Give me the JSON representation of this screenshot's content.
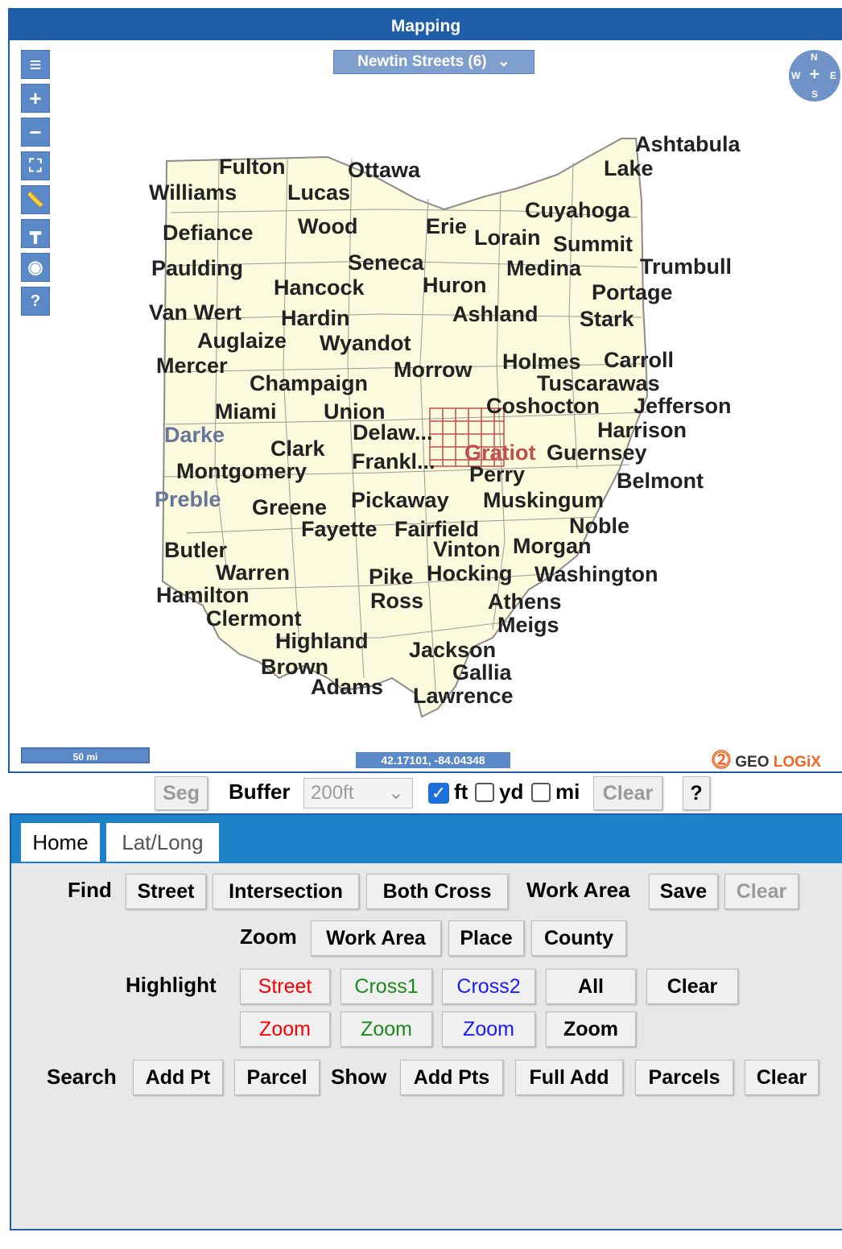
{
  "window": {
    "title": "Mapping"
  },
  "map": {
    "layer_selector": "Newtin Streets (6)",
    "compass": {
      "n": "N",
      "s": "S",
      "e": "E",
      "w": "W"
    },
    "tools": [
      "menu-icon",
      "zoom-in-icon",
      "zoom-out-icon",
      "full-extent-icon",
      "measure-icon",
      "street-view-icon",
      "visibility-icon",
      "help-icon"
    ],
    "scale_label": "50 mi",
    "coordinates": "42.17101, -84.04348",
    "logo": {
      "geo": "GEO",
      "logix": "LOGiX"
    },
    "counties": [
      {
        "name": "Ashtabula"
      },
      {
        "name": "Lake"
      },
      {
        "name": "Fulton"
      },
      {
        "name": "Ottawa"
      },
      {
        "name": "Williams"
      },
      {
        "name": "Lucas"
      },
      {
        "name": "Cuyahoga"
      },
      {
        "name": "Defiance"
      },
      {
        "name": "Wood"
      },
      {
        "name": "Erie"
      },
      {
        "name": "Lorain"
      },
      {
        "name": "Summit"
      },
      {
        "name": "Paulding"
      },
      {
        "name": "Seneca"
      },
      {
        "name": "Medina"
      },
      {
        "name": "Trumbull"
      },
      {
        "name": "Hancock"
      },
      {
        "name": "Huron"
      },
      {
        "name": "Portage"
      },
      {
        "name": "Van Wert"
      },
      {
        "name": "Hardin"
      },
      {
        "name": "Ashland"
      },
      {
        "name": "Stark"
      },
      {
        "name": "Auglaize"
      },
      {
        "name": "Wyandot"
      },
      {
        "name": "Mercer"
      },
      {
        "name": "Morrow"
      },
      {
        "name": "Holmes"
      },
      {
        "name": "Carroll"
      },
      {
        "name": "Champaign"
      },
      {
        "name": "Tuscarawas"
      },
      {
        "name": "Miami"
      },
      {
        "name": "Union"
      },
      {
        "name": "Coshocton"
      },
      {
        "name": "Jefferson"
      },
      {
        "name": "Darke"
      },
      {
        "name": "Delaw..."
      },
      {
        "name": "Harrison"
      },
      {
        "name": "Clark"
      },
      {
        "name": "Gratiot"
      },
      {
        "name": "Guernsey"
      },
      {
        "name": "Montgomery"
      },
      {
        "name": "Frankl..."
      },
      {
        "name": "Perry"
      },
      {
        "name": "Belmont"
      },
      {
        "name": "Preble"
      },
      {
        "name": "Greene"
      },
      {
        "name": "Pickaway"
      },
      {
        "name": "Muskingum"
      },
      {
        "name": "Fayette"
      },
      {
        "name": "Fairfield"
      },
      {
        "name": "Noble"
      },
      {
        "name": "Butler"
      },
      {
        "name": "Vinton"
      },
      {
        "name": "Morgan"
      },
      {
        "name": "Warren"
      },
      {
        "name": "Pike"
      },
      {
        "name": "Hocking"
      },
      {
        "name": "Washington"
      },
      {
        "name": "Hamilton"
      },
      {
        "name": "Ross"
      },
      {
        "name": "Athens"
      },
      {
        "name": "Clermont"
      },
      {
        "name": "Meigs"
      },
      {
        "name": "Highland"
      },
      {
        "name": "Jackson"
      },
      {
        "name": "Brown"
      },
      {
        "name": "Gallia"
      },
      {
        "name": "Adams"
      },
      {
        "name": "Lawrence"
      }
    ]
  },
  "buffer_bar": {
    "seg": "Seg",
    "buffer_label": "Buffer",
    "buffer_value": "200ft",
    "ft": "ft",
    "yd": "yd",
    "mi": "mi",
    "ft_checked": true,
    "yd_checked": false,
    "mi_checked": false,
    "clear": "Clear",
    "help": "?"
  },
  "tabs": {
    "home": "Home",
    "latlong": "Lat/Long"
  },
  "find": {
    "label": "Find",
    "street": "Street",
    "intersection": "Intersection",
    "both_cross": "Both Cross"
  },
  "work_area": {
    "label": "Work Area",
    "save": "Save",
    "clear": "Clear"
  },
  "zoom": {
    "label": "Zoom",
    "work_area": "Work Area",
    "place": "Place",
    "county": "County"
  },
  "highlight": {
    "label": "Highlight",
    "street": "Street",
    "cross1": "Cross1",
    "cross2": "Cross2",
    "all": "All",
    "clear": "Clear",
    "zoom": "Zoom",
    "colors": {
      "street": "#ff0000",
      "cross1": "#1e8a1e",
      "cross2": "#1a1aff"
    }
  },
  "search": {
    "label": "Search",
    "add_pt": "Add Pt",
    "parcel": "Parcel"
  },
  "show": {
    "label": "Show",
    "add_pts": "Add Pts",
    "full_add": "Full Add",
    "parcels": "Parcels",
    "clear": "Clear"
  },
  "colors": {
    "accent": "#1f5ea8",
    "tab_bar": "#1f82c8",
    "map_fill": "#fcfadc",
    "highlight_county": "#c0504d"
  }
}
